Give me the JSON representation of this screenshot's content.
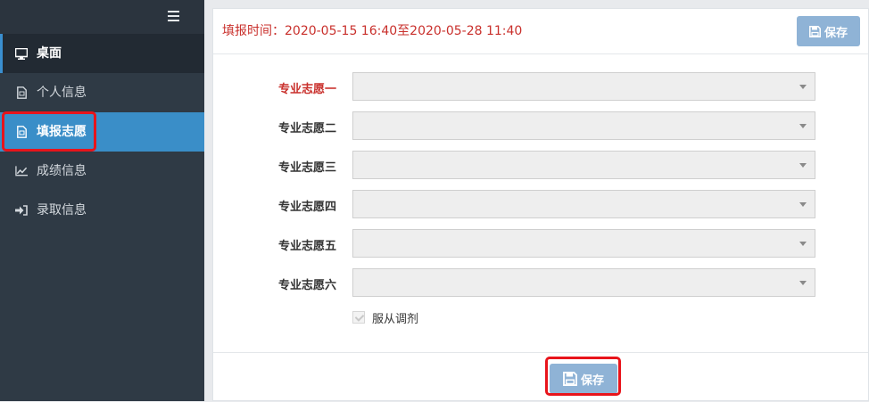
{
  "sidebar": {
    "items": [
      {
        "label": "桌面",
        "icon": "monitor-icon"
      },
      {
        "label": "个人信息",
        "icon": "document-icon"
      },
      {
        "label": "填报志愿",
        "icon": "document-icon"
      },
      {
        "label": "成绩信息",
        "icon": "line-chart-icon"
      },
      {
        "label": "录取信息",
        "icon": "sign-in-icon"
      }
    ],
    "active_index": 2
  },
  "header": {
    "fill_time": "填报时间：2020-05-15 16:40至2020-05-28 11:40",
    "save_label": "保存"
  },
  "form": {
    "fields": [
      {
        "label": "专业志愿一",
        "value": "",
        "required_style": true
      },
      {
        "label": "专业志愿二",
        "value": ""
      },
      {
        "label": "专业志愿三",
        "value": ""
      },
      {
        "label": "专业志愿四",
        "value": ""
      },
      {
        "label": "专业志愿五",
        "value": ""
      },
      {
        "label": "专业志愿六",
        "value": ""
      }
    ],
    "adjust_label": "服从调剂",
    "adjust_checked": true
  },
  "footer": {
    "save_label": "保存"
  },
  "colors": {
    "sidebar_bg": "#2f3a45",
    "active_bg": "#3a8ec8",
    "accent_red": "#c9302c",
    "button_bg": "#8fb3d6",
    "highlight": "#e8141b"
  }
}
